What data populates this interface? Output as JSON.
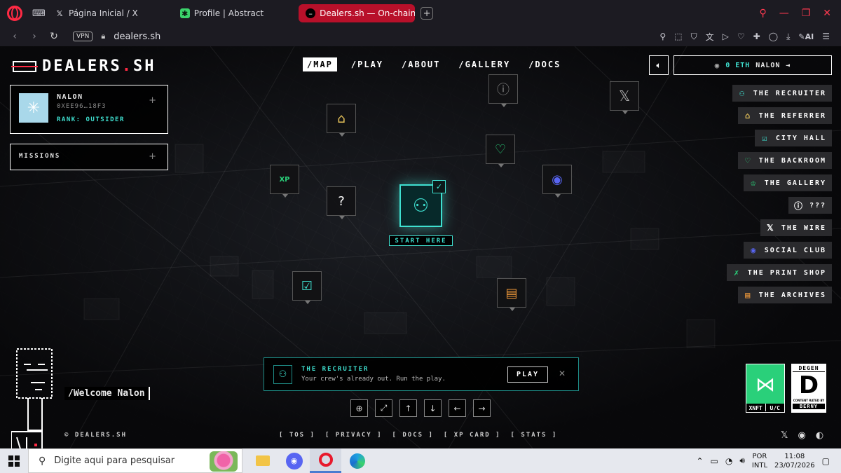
{
  "browser": {
    "tabs": [
      {
        "title": "Página Inicial / X",
        "icon": "x-icon"
      },
      {
        "title": "Profile | Abstract",
        "icon": "abstract-icon"
      },
      {
        "title": "Dealers.sh — On-chain",
        "icon": "muted-speaker-icon",
        "active": true
      }
    ],
    "vpn_label": "VPN",
    "url": "dealers.sh",
    "ai_label": "AI",
    "accent_color": "#ff2a44"
  },
  "site": {
    "logo_text": "DEALERS",
    "logo_dot": ".",
    "logo_tld": "SH",
    "nav": [
      "/MAP",
      "/PLAY",
      "/ABOUT",
      "/GALLERY",
      "/DOCS"
    ],
    "active_nav": "/MAP",
    "wallet": {
      "amount": "0 ETH",
      "user": "NALON"
    },
    "accent_color": "#3fe0d0"
  },
  "profile": {
    "name": "NALON",
    "address": "0XEE96…18F3",
    "rank": "RANK: OUTSIDER",
    "expand_symbol": "+"
  },
  "missions": {
    "label": "MISSIONS",
    "expand_symbol": "+"
  },
  "map": {
    "nodes": [
      {
        "id": "question-top",
        "icon": "question-icon"
      },
      {
        "id": "x",
        "icon": "x-icon"
      },
      {
        "id": "gift",
        "icon": "gift-icon"
      },
      {
        "id": "handshake",
        "icon": "handshake-icon"
      },
      {
        "id": "xp",
        "icon": "xp-icon",
        "text": "XP"
      },
      {
        "id": "question",
        "icon": "question-icon"
      },
      {
        "id": "discord",
        "icon": "discord-icon"
      },
      {
        "id": "city-hall",
        "icon": "city-hall-icon"
      },
      {
        "id": "archives",
        "icon": "document-icon"
      }
    ],
    "start_label": "START HERE"
  },
  "locations": [
    {
      "label": "THE RECRUITER",
      "icon": "add-user-icon",
      "color": "#3fe0d0"
    },
    {
      "label": "THE REFERRER",
      "icon": "gift-icon",
      "color": "#e8c45a"
    },
    {
      "label": "CITY HALL",
      "icon": "city-hall-icon",
      "color": "#3fe0d0"
    },
    {
      "label": "THE BACKROOM",
      "icon": "handshake-icon",
      "color": "#2ad07a"
    },
    {
      "label": "THE GALLERY",
      "icon": "crown-icon",
      "color": "#2ad07a"
    },
    {
      "label": "???",
      "icon": "question-icon",
      "color": "#ffffff"
    },
    {
      "label": "THE WIRE",
      "icon": "x-icon",
      "color": "#ffffff"
    },
    {
      "label": "SOCIAL CLUB",
      "icon": "discord-icon",
      "color": "#5865f2"
    },
    {
      "label": "THE PRINT SHOP",
      "icon": "xp-icon",
      "color": "#2ad07a"
    },
    {
      "label": "THE ARCHIVES",
      "icon": "document-icon",
      "color": "#f29a3a"
    }
  ],
  "welcome_text": "/Welcome Nalon",
  "notification": {
    "title": "THE RECRUITER",
    "body": "Your crew's already out. Run the play.",
    "play_label": "PLAY"
  },
  "map_controls": [
    "crosshair-icon",
    "expand-icon",
    "arrow-up-icon",
    "arrow-down-icon",
    "arrow-left-icon",
    "arrow-right-icon"
  ],
  "badges": {
    "xnft": {
      "left": "XNFT",
      "right": "U/C"
    },
    "degen": {
      "top": "DEGEN",
      "letter": "D",
      "small": "CONTENT RATED BY",
      "bottom": "BERNY"
    }
  },
  "footer": {
    "copyright": "© DEALERS.SH",
    "links": [
      "[ TOS ]",
      "[ PRIVACY ]",
      "[ DOCS ]",
      "[ XP CARD ]",
      "[ STATS ]"
    ]
  },
  "taskbar": {
    "search_placeholder": "Digite aqui para pesquisar",
    "lang_top": "POR",
    "lang_bottom": "INTL",
    "time": "11:08",
    "date": "23/07/2026"
  }
}
